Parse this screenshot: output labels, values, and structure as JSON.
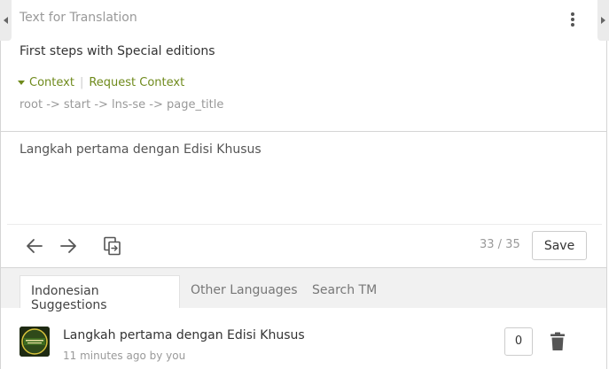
{
  "header": {
    "title": "Text for Translation"
  },
  "source": {
    "text": "First steps with Special editions",
    "context_label": "Context",
    "request_context_label": "Request Context",
    "path": "root -> start -> lns-se -> page_title"
  },
  "translation": {
    "value": "Langkah pertama dengan Edisi Khusus"
  },
  "toolbar": {
    "counter": "33 / 35",
    "save_label": "Save"
  },
  "tabs": [
    {
      "label": "Indonesian Suggestions",
      "active": true
    },
    {
      "label": "Other Languages",
      "active": false
    },
    {
      "label": "Search TM",
      "active": false
    }
  ],
  "suggestion": {
    "text": "Langkah pertama dengan Edisi Khusus",
    "meta": "11 minutes ago by you",
    "votes": "0"
  },
  "colors": {
    "accent": "#6f8a1c",
    "tab_bar": "#f1f1f1",
    "border": "#d5d5d5"
  }
}
